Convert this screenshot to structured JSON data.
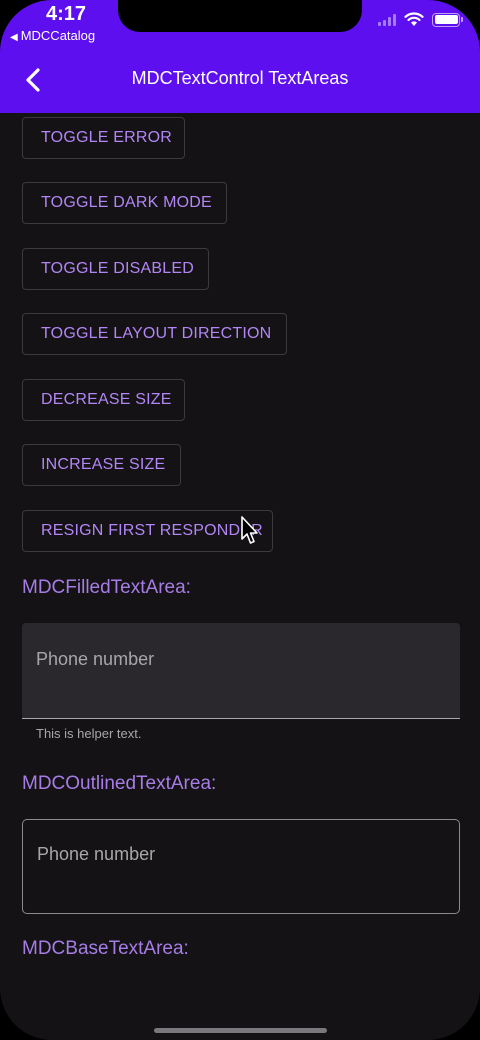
{
  "status_bar": {
    "time": "4:17",
    "back_app": "MDCCatalog"
  },
  "nav": {
    "title": "MDCTextControl TextAreas",
    "back_icon": "chevron-left-icon"
  },
  "buttons": [
    {
      "label": "TOGGLE ERROR"
    },
    {
      "label": "TOGGLE DARK MODE"
    },
    {
      "label": "TOGGLE DISABLED"
    },
    {
      "label": "TOGGLE LAYOUT DIRECTION"
    },
    {
      "label": "DECREASE SIZE"
    },
    {
      "label": "INCREASE SIZE"
    },
    {
      "label": "RESIGN FIRST RESPONDER"
    }
  ],
  "filled": {
    "label": "MDCFilledTextArea:",
    "placeholder": "Phone number",
    "helper": "This is helper text."
  },
  "outlined": {
    "label": "MDCOutlinedTextArea:",
    "placeholder": "Phone number"
  },
  "base": {
    "label": "MDCBaseTextArea:"
  },
  "colors": {
    "app_bar": "#5d0ff0",
    "accent_text": "#b286f5",
    "background": "#141214"
  }
}
